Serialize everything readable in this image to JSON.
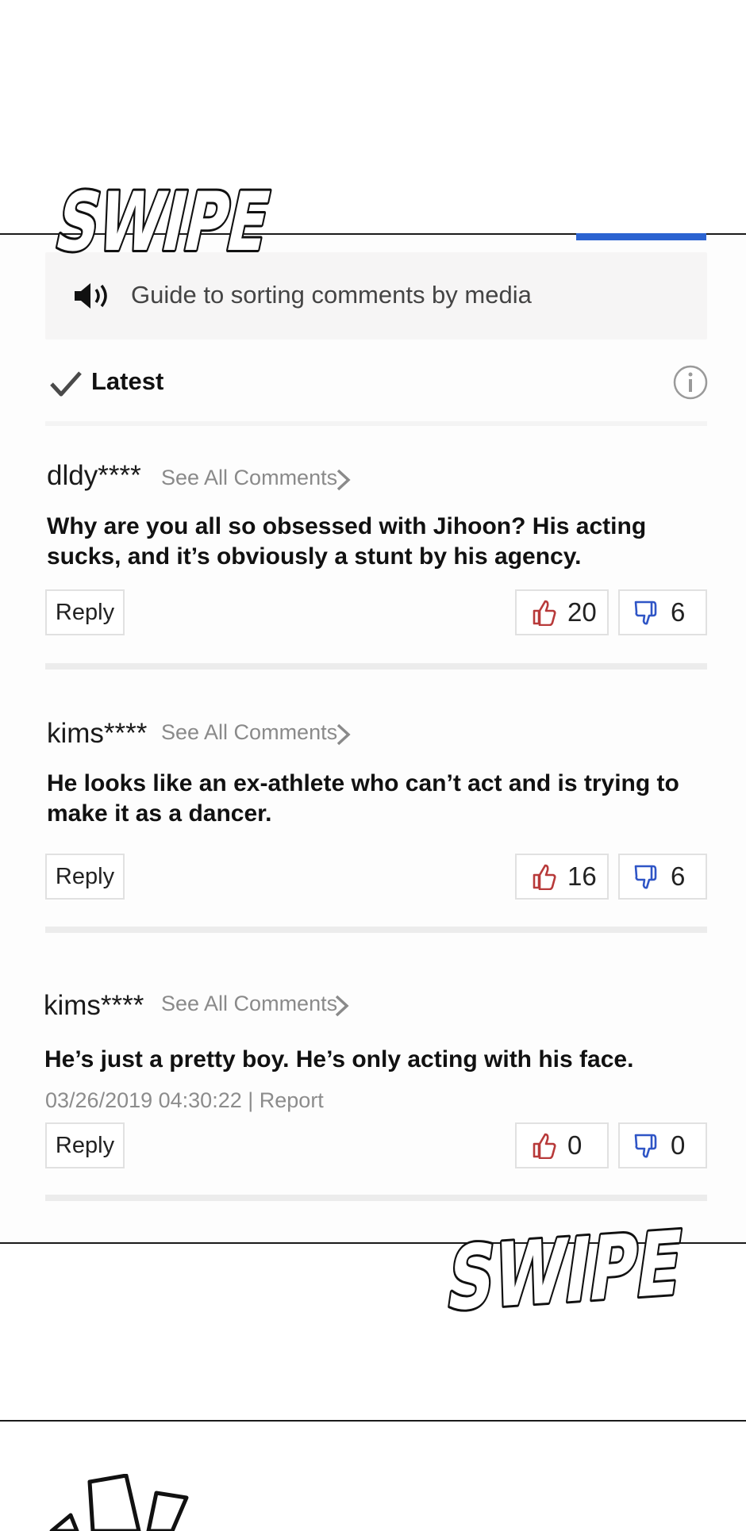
{
  "sfx": {
    "top": "SWIPE",
    "bottom": "SWIPE"
  },
  "guide": {
    "icon": "speaker-icon",
    "text": "Guide to sorting comments by media"
  },
  "sort": {
    "icon": "checkmark-icon",
    "label": "Latest",
    "info_icon": "info-icon"
  },
  "comments": [
    {
      "username": "dldy****",
      "see_all": "See All Comments",
      "text": "Why are you all so obsessed with Jihoon? His acting sucks, and it’s obviously a stunt by his agency.",
      "reply": "Reply",
      "likes": "20",
      "dislikes": "6"
    },
    {
      "username": "kims****",
      "see_all": "See All Comments",
      "text": "He looks like an ex-athlete who can’t act and is trying to make it as a dancer.",
      "reply": "Reply",
      "likes": "16",
      "dislikes": "6"
    },
    {
      "username": "kims****",
      "see_all": "See All Comments",
      "text": "He’s just a pretty boy. He’s only acting with his face.",
      "timestamp": "03/26/2019 04:30:22",
      "report": "Report",
      "reply": "Reply",
      "likes": "0",
      "dislikes": "0"
    }
  ],
  "colors": {
    "accent_blue": "#2b63d1",
    "like_red": "#b83a3a",
    "dislike_blue": "#2f55c6",
    "separator": "#ececec"
  }
}
